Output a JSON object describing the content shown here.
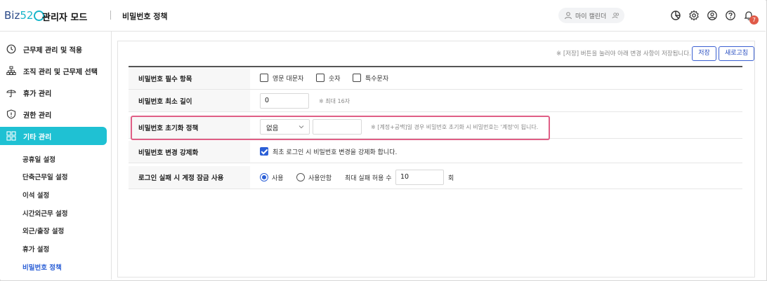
{
  "header": {
    "logo_text": "Biz52",
    "admin_title": "관리자 모드",
    "page_title": "비밀번호 정책",
    "user_label": "마이 캘린더",
    "notification_count": "7"
  },
  "sidebar": {
    "items": [
      {
        "label": "근무제 관리 및 적용",
        "icon": "clock-icon"
      },
      {
        "label": "조직 관리 및 근무제 선택",
        "icon": "org-chart-icon"
      },
      {
        "label": "휴가 관리",
        "icon": "umbrella-icon"
      },
      {
        "label": "권한 관리",
        "icon": "shield-icon"
      },
      {
        "label": "기타 관리",
        "icon": "grid-icon"
      }
    ],
    "subitems": [
      "공휴일 설정",
      "단축근무일 설정",
      "이석 설정",
      "시간외근무 설정",
      "외근/출장 설정",
      "휴가 설정",
      "비밀번호 정책"
    ]
  },
  "toolbar": {
    "notice": "※ [저장] 버튼을 눌러야 아래 변경 사항이 저장됩니다.",
    "save_label": "저장",
    "refresh_label": "새로고침"
  },
  "rows": {
    "required": {
      "label": "비밀번호 필수 항목",
      "options": [
        "영문 대문자",
        "숫자",
        "특수문자"
      ]
    },
    "min_length": {
      "label": "비밀번호 최소 길이",
      "value": "0",
      "hint": "※ 최대 16자"
    },
    "reset_policy": {
      "label": "비밀번호 초기화 정책",
      "selected": "없음",
      "text_value": "",
      "hint": "※ [계정+공백]일 경우 비밀번호 초기화 시 비밀번호는 '계정'이 됩니다."
    },
    "force_change": {
      "label": "비밀번호 변경 강제화",
      "checkbox_label": "최초 로그인 시 비밀번호 변경을 강제화 합니다."
    },
    "lock": {
      "label": "로그인 실패 시 계정 잠금 사용",
      "use_label": "사용",
      "nouse_label": "사용안함",
      "max_label": "최대 실패 허용 수",
      "max_value": "10",
      "unit": "회"
    }
  },
  "colors": {
    "accent": "#1fc1d3",
    "primary": "#2b5fd6",
    "highlight": "#e05f86"
  }
}
